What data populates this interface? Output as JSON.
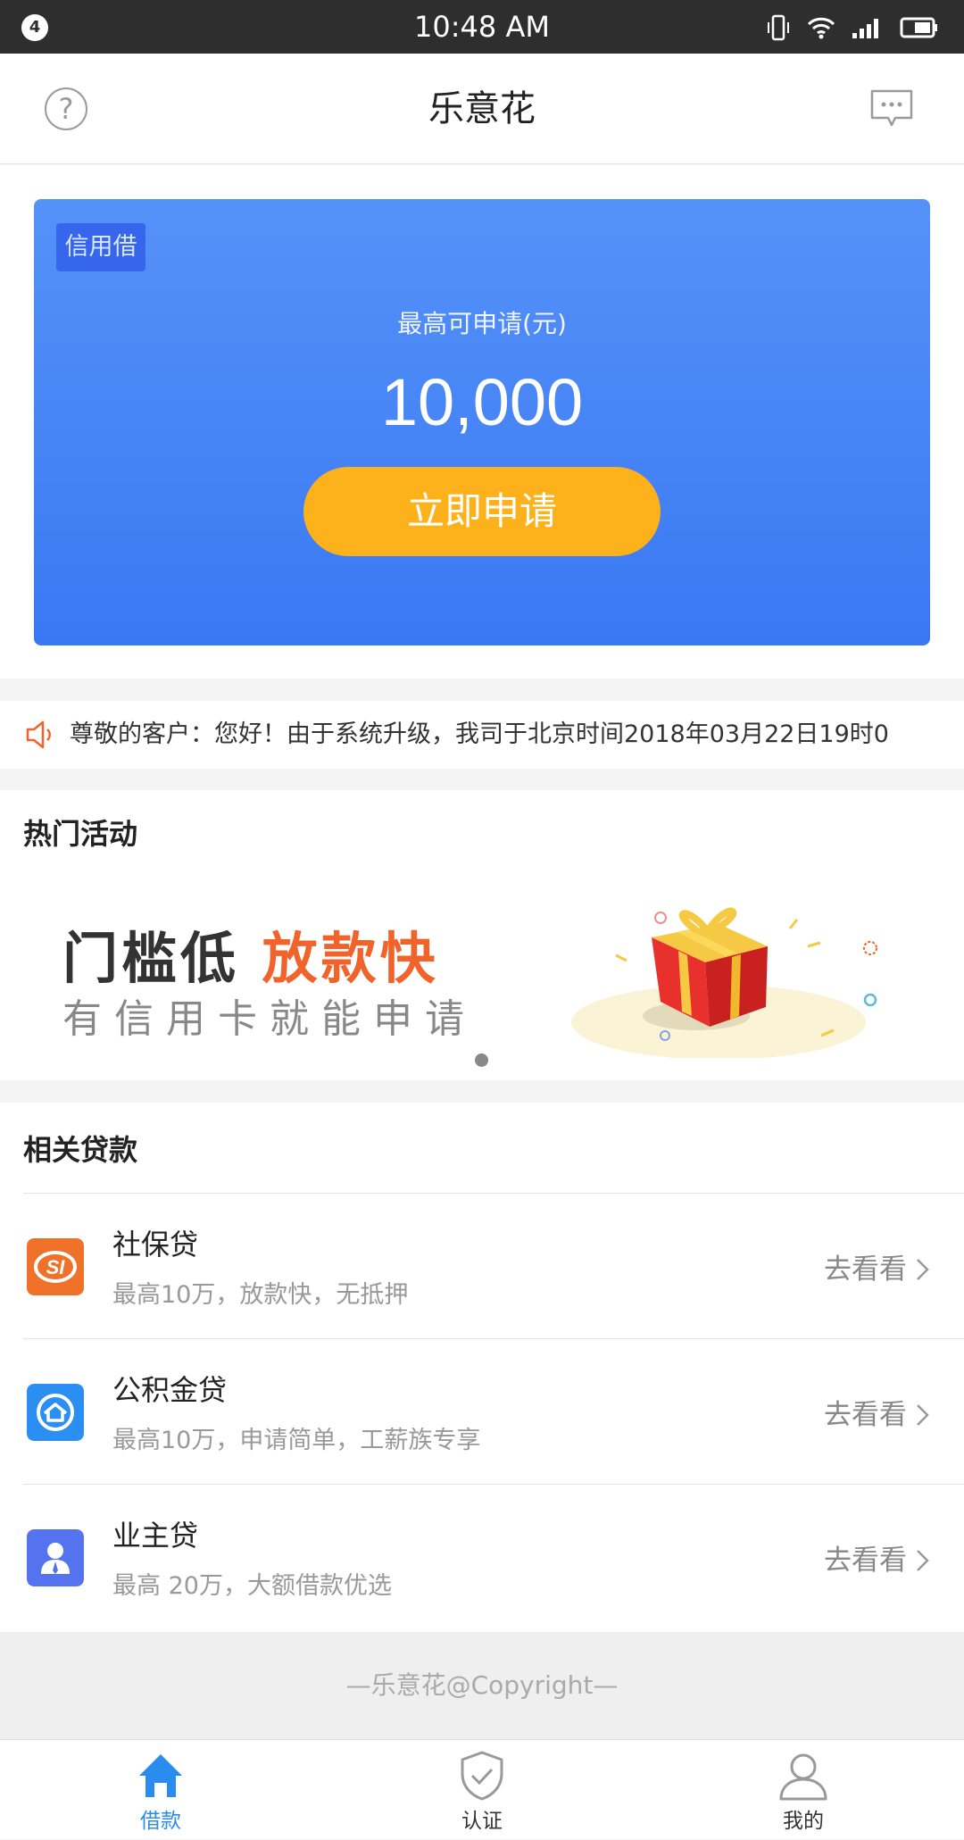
{
  "status_bar": {
    "notification_count": "4",
    "time": "10:48 AM"
  },
  "nav": {
    "title": "乐意花"
  },
  "credit": {
    "tag": "信用借",
    "label": "最高可申请(元)",
    "amount": "10,000",
    "apply_button": "立即申请",
    "colors": {
      "card": "#3f7ff4",
      "button": "#fdb11a"
    }
  },
  "notice": {
    "text": "尊敬的客户：您好！由于系统升级，我司于北京时间2018年03月22日19时0"
  },
  "activity": {
    "title": "热门活动",
    "banner_headline_dark": "门槛低",
    "banner_headline_accent": "放款快",
    "banner_sub": "有信用卡就能申请"
  },
  "loans": {
    "title": "相关贷款",
    "items": [
      {
        "name": "社保贷",
        "desc": "最高10万，放款快，无抵押",
        "action": "去看看",
        "icon": "social-security-icon"
      },
      {
        "name": "公积金贷",
        "desc": "最高10万，申请简单，工薪族专享",
        "action": "去看看",
        "icon": "housing-fund-icon"
      },
      {
        "name": "业主贷",
        "desc": "最高 20万，大额借款优选",
        "action": "去看看",
        "icon": "owner-icon"
      }
    ]
  },
  "footer": {
    "copyright": "—乐意花@Copyright—"
  },
  "tabbar": {
    "tabs": [
      {
        "label": "借款",
        "icon": "home-icon",
        "active": true
      },
      {
        "label": "认证",
        "icon": "shield-check-icon",
        "active": false
      },
      {
        "label": "我的",
        "icon": "user-icon",
        "active": false
      }
    ]
  }
}
